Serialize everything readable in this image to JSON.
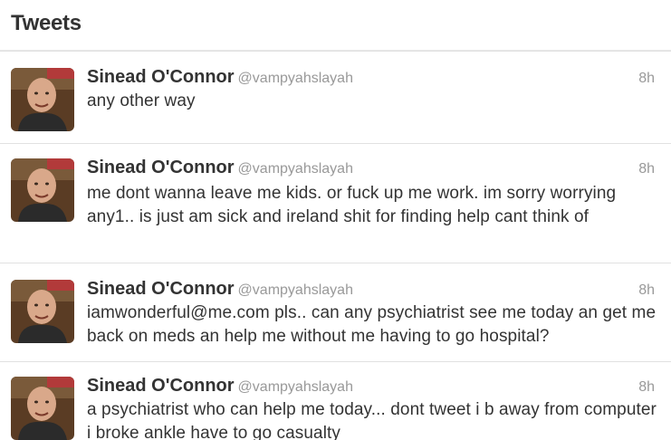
{
  "header": {
    "title": "Tweets"
  },
  "tweets": [
    {
      "name": "Sinead O'Connor",
      "handle": "@vampyahslayah",
      "time": "8h",
      "text": "any other way"
    },
    {
      "name": "Sinead O'Connor",
      "handle": "@vampyahslayah",
      "time": "8h",
      "text": "me dont wanna leave me kids. or fuck up me work. im sorry worrying any1.. is just am sick and ireland shit for finding help cant think of"
    },
    {
      "name": "Sinead O'Connor",
      "handle": "@vampyahslayah",
      "time": "8h",
      "text": "iamwonderful@me.com pls.. can any psychiatrist see me today an get me back on meds an help me without me having to go hospital?"
    },
    {
      "name": "Sinead O'Connor",
      "handle": "@vampyahslayah",
      "time": "8h",
      "text": "a psychiatrist who can help me today... dont tweet i b away from computer i broke ankle have to go casualty"
    }
  ],
  "colors": {
    "name": "#333333",
    "handle": "#999999",
    "divider": "#e1e1e1",
    "avatar_bg": "#6b4a2e"
  },
  "icons": {
    "avatar": "user-avatar-photo"
  }
}
